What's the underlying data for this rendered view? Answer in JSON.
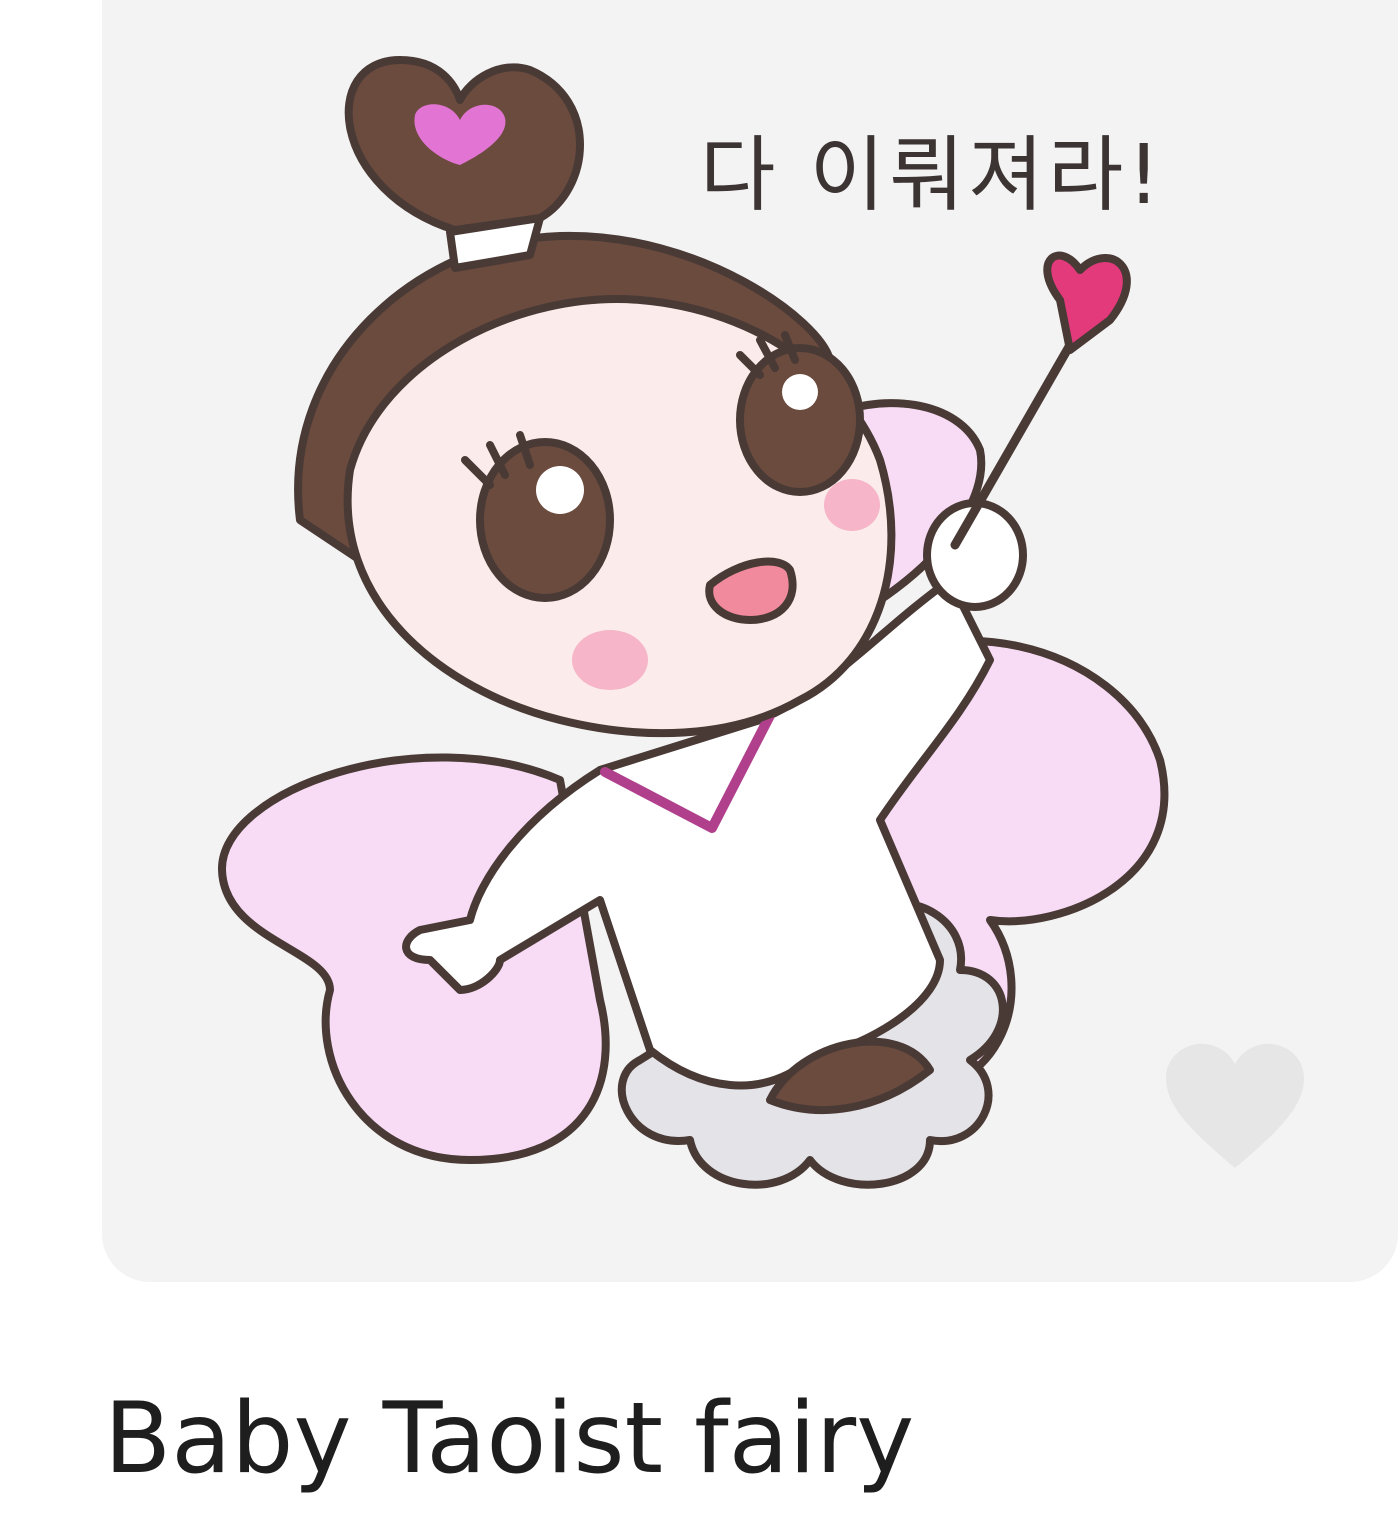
{
  "sticker": {
    "speech_text": "다 이뤄져라!",
    "caption": "Baby Taoist fairy",
    "favorite_icon": "heart-icon"
  },
  "colors": {
    "card_bg": "#f3f3f3",
    "outline": "#4a3a36",
    "hair": "#6b4b3e",
    "wing": "#f8dcf5",
    "skin": "#fbeceb",
    "favorite_heart": "#e6e6e6"
  }
}
